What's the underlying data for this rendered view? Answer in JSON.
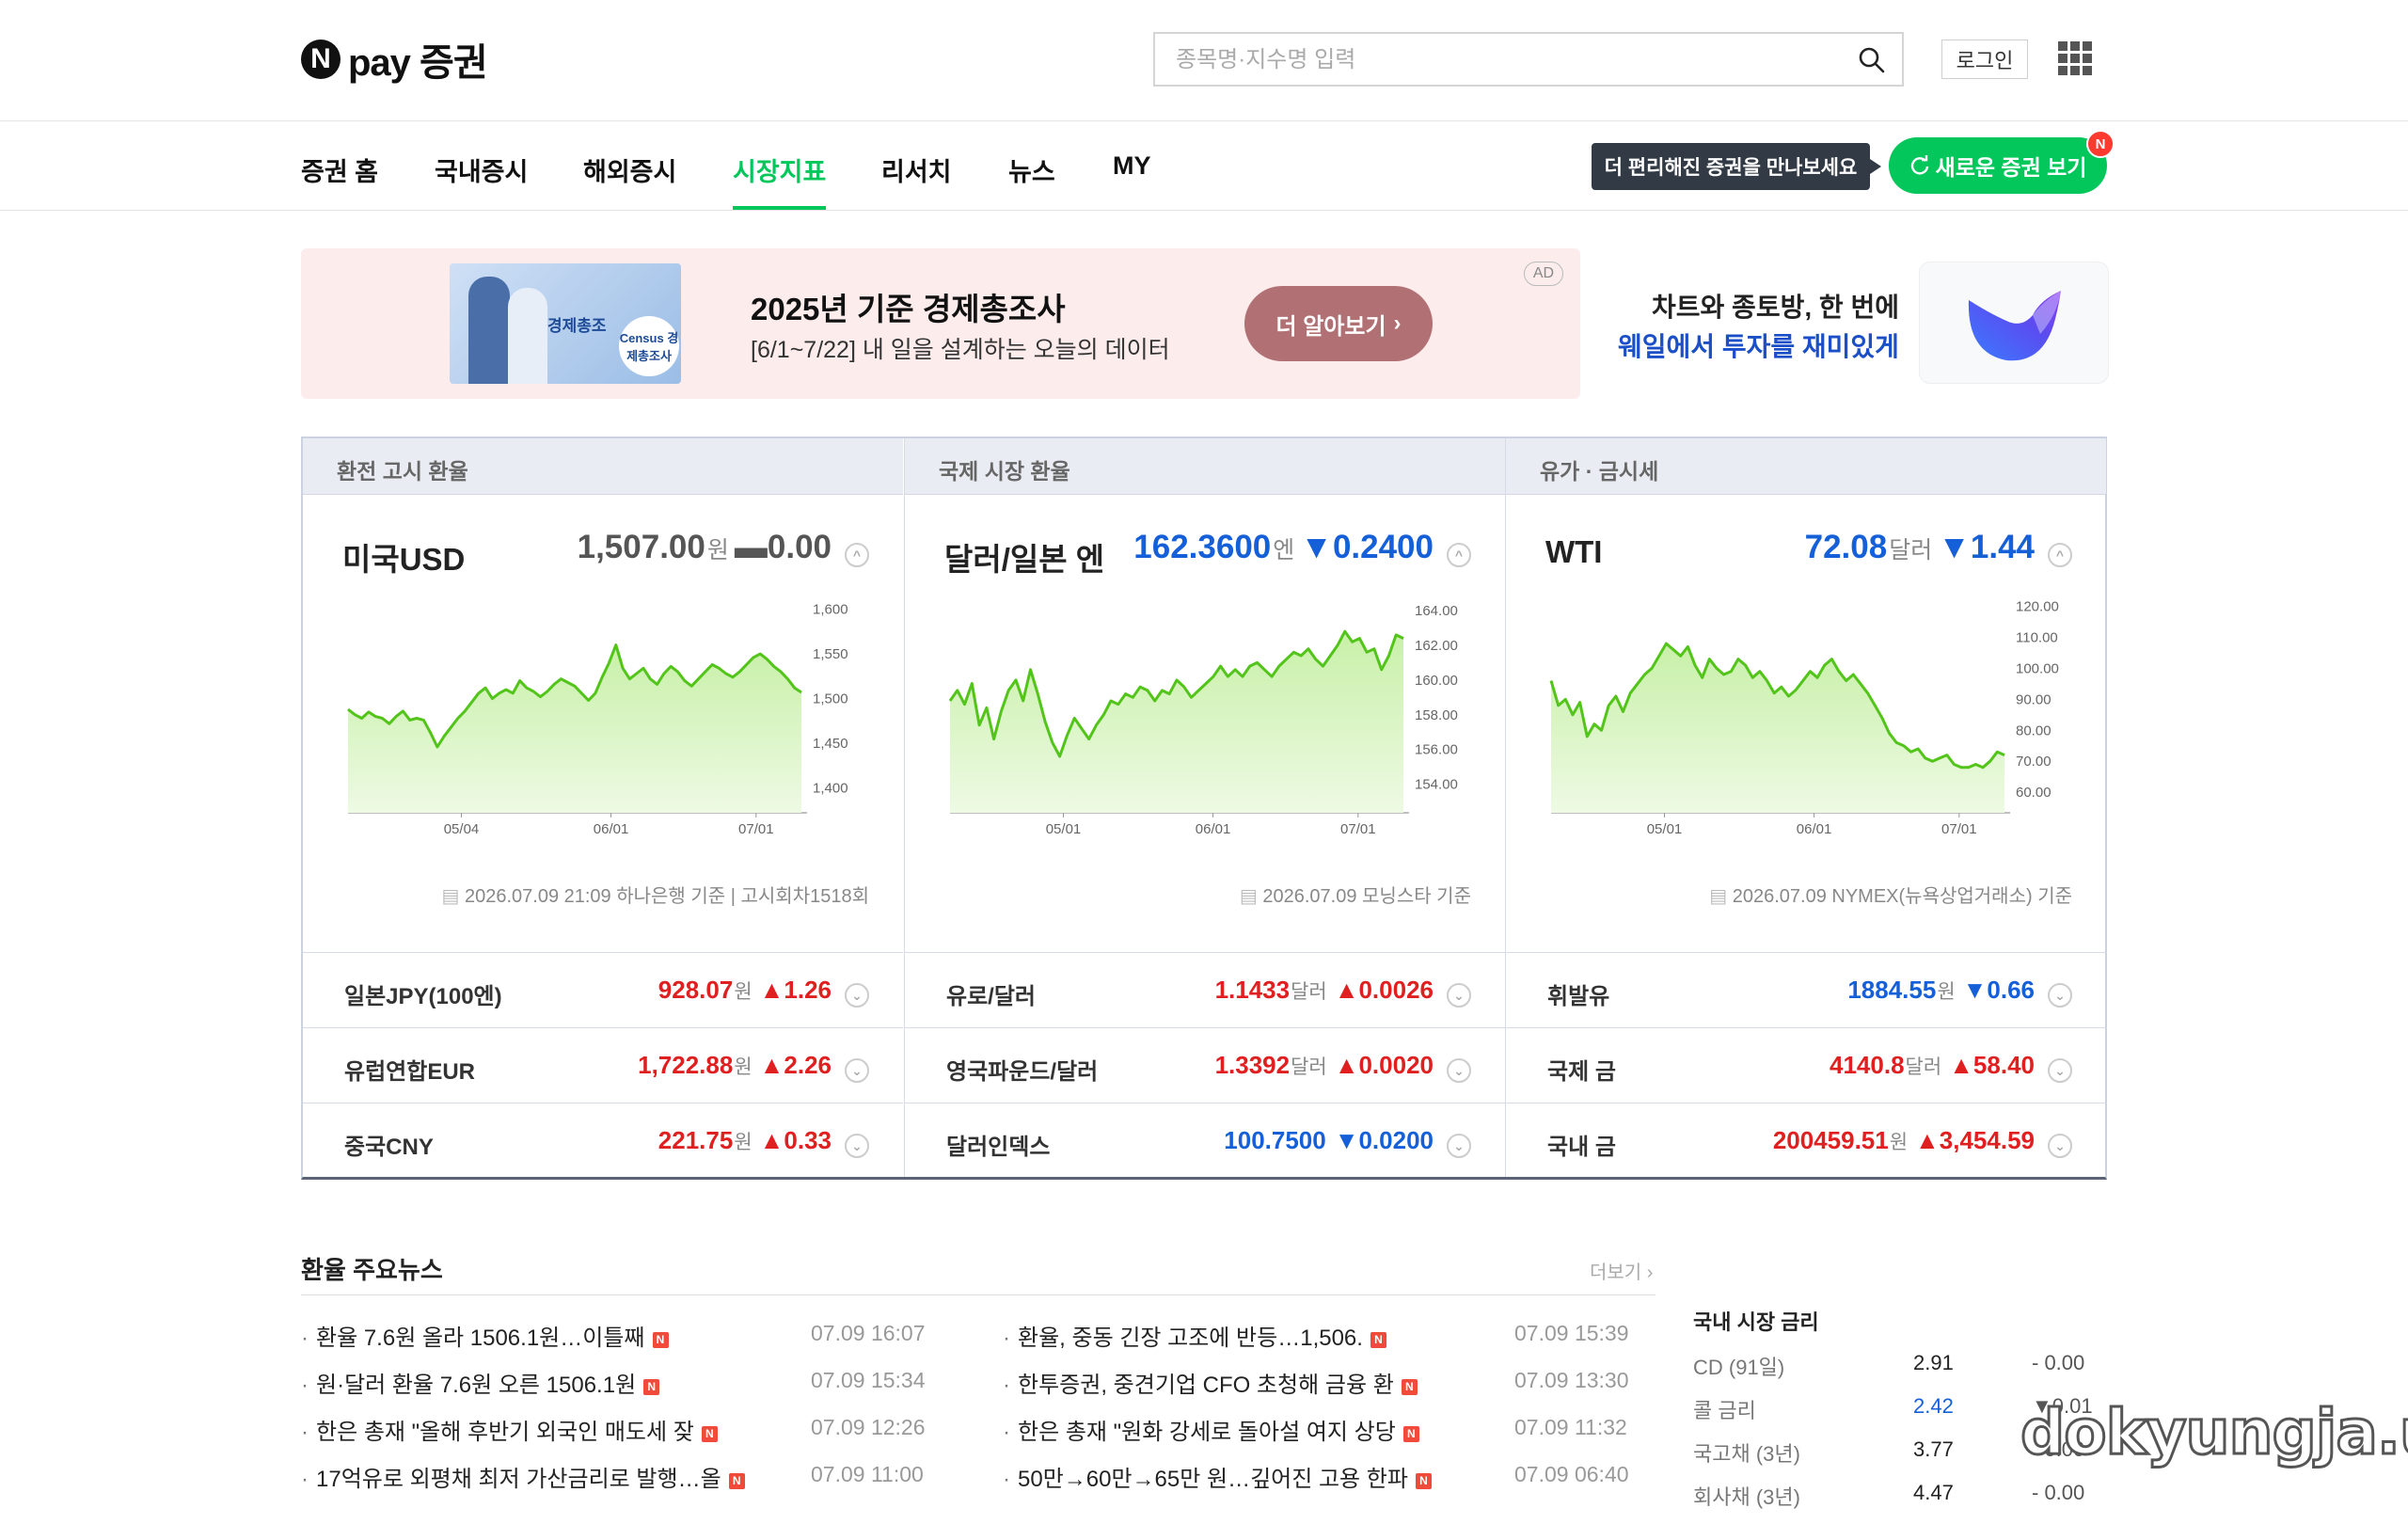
{
  "header": {
    "logo_n": "N",
    "logo_text": "pay 증권",
    "search_placeholder": "종목명·지수명 입력",
    "login_label": "로그인"
  },
  "nav": {
    "items": [
      "증권 홈",
      "국내증시",
      "해외증시",
      "시장지표",
      "리서치",
      "뉴스",
      "MY"
    ],
    "active": "시장지표",
    "tooltip": "더 편리해진 증권을 만나보세요",
    "new_button": "새로운 증권 보기",
    "new_badge": "N"
  },
  "ad": {
    "title": "2025년 기준 경제총조사",
    "subtitle": "[6/1~7/22] 내 일을 설계하는 오늘의 데이터",
    "button": "더 알아보기",
    "tag": "AD",
    "image_text": "경제총조",
    "image_badge": "Census 경제총조사"
  },
  "whale": {
    "line1": "차트와 종토방, 한 번에",
    "line2": "웨일에서 투자를 재미있게"
  },
  "market": {
    "columns": [
      {
        "header": "환전 고시 환율",
        "main": {
          "name": "미국USD",
          "value": "1,507.00",
          "unit": "원",
          "change": "0.00",
          "direction": "flat"
        },
        "source": "2026.07.09 21:09 하나은행 기준 | 고시회차1518회",
        "rows": [
          {
            "name": "일본JPY(100엔)",
            "value": "928.07",
            "unit": "원",
            "change": "1.26",
            "direction": "up"
          },
          {
            "name": "유럽연합EUR",
            "value": "1,722.88",
            "unit": "원",
            "change": "2.26",
            "direction": "up"
          },
          {
            "name": "중국CNY",
            "value": "221.75",
            "unit": "원",
            "change": "0.33",
            "direction": "up"
          }
        ]
      },
      {
        "header": "국제 시장 환율",
        "main": {
          "name": "달러/일본 엔",
          "value": "162.3600",
          "unit": "엔",
          "change": "0.2400",
          "direction": "down"
        },
        "source": "2026.07.09 모닝스타 기준",
        "rows": [
          {
            "name": "유로/달러",
            "value": "1.1433",
            "unit": "달러",
            "change": "0.0026",
            "direction": "up"
          },
          {
            "name": "영국파운드/달러",
            "value": "1.3392",
            "unit": "달러",
            "change": "0.0020",
            "direction": "up"
          },
          {
            "name": "달러인덱스",
            "value": "100.7500",
            "unit": "",
            "change": "0.0200",
            "direction": "down"
          }
        ]
      },
      {
        "header": "유가 · 금시세",
        "main": {
          "name": "WTI",
          "value": "72.08",
          "unit": "달러",
          "change": "1.44",
          "direction": "down"
        },
        "source": "2026.07.09 NYMEX(뉴욕상업거래소) 기준",
        "rows": [
          {
            "name": "휘발유",
            "value": "1884.55",
            "unit": "원",
            "change": "0.66",
            "direction": "down"
          },
          {
            "name": "국제 금",
            "value": "4140.8",
            "unit": "달러",
            "change": "58.40",
            "direction": "up"
          },
          {
            "name": "국내 금",
            "value": "200459.51",
            "unit": "원",
            "change": "3,454.59",
            "direction": "up"
          }
        ]
      }
    ]
  },
  "chart_data": [
    {
      "type": "area",
      "series_name": "미국USD",
      "x_ticks": [
        "05/04",
        "06/01",
        "07/01"
      ],
      "y_ticks": [
        "1,400",
        "1,450",
        "1,500",
        "1,550",
        "1,600"
      ],
      "ylim": [
        1385,
        1610
      ],
      "values": [
        1488,
        1482,
        1478,
        1485,
        1480,
        1478,
        1472,
        1480,
        1486,
        1476,
        1478,
        1476,
        1462,
        1446,
        1458,
        1468,
        1478,
        1486,
        1496,
        1506,
        1512,
        1500,
        1506,
        1510,
        1506,
        1520,
        1512,
        1508,
        1502,
        1508,
        1516,
        1522,
        1518,
        1514,
        1506,
        1498,
        1506,
        1524,
        1540,
        1560,
        1534,
        1522,
        1528,
        1534,
        1522,
        1516,
        1528,
        1536,
        1530,
        1520,
        1514,
        1522,
        1530,
        1538,
        1534,
        1528,
        1524,
        1530,
        1538,
        1546,
        1550,
        1544,
        1536,
        1530,
        1522,
        1512,
        1507
      ]
    },
    {
      "type": "area",
      "series_name": "달러/일본 엔",
      "x_ticks": [
        "05/01",
        "06/01",
        "07/01"
      ],
      "y_ticks": [
        "154.00",
        "156.00",
        "158.00",
        "160.00",
        "162.00",
        "164.00"
      ],
      "ylim": [
        153,
        164.6
      ],
      "values": [
        158.8,
        159.4,
        158.6,
        159.8,
        157.4,
        158.4,
        156.6,
        158.2,
        159.4,
        160.0,
        158.8,
        160.6,
        159.2,
        157.6,
        156.4,
        155.6,
        156.8,
        157.8,
        157.2,
        156.6,
        157.4,
        158.0,
        158.8,
        158.6,
        159.2,
        159.0,
        159.6,
        159.4,
        158.8,
        159.4,
        159.2,
        160.0,
        159.6,
        159.0,
        159.4,
        159.8,
        160.2,
        160.8,
        160.2,
        160.6,
        160.2,
        160.8,
        161.0,
        160.6,
        160.2,
        160.8,
        161.2,
        161.6,
        161.4,
        161.8,
        161.2,
        160.8,
        161.4,
        162.0,
        162.8,
        162.2,
        162.4,
        161.6,
        161.8,
        160.6,
        161.4,
        162.6,
        162.4
      ]
    },
    {
      "type": "area",
      "series_name": "WTI",
      "x_ticks": [
        "05/01",
        "06/01",
        "07/01"
      ],
      "y_ticks": [
        "60.00",
        "70.00",
        "80.00",
        "90.00",
        "100.00",
        "110.00",
        "120.00"
      ],
      "ylim": [
        57,
        122
      ],
      "values": [
        96,
        88,
        90,
        85,
        89,
        78,
        82,
        80,
        88,
        91,
        86,
        92,
        95,
        98,
        100,
        104,
        108,
        106,
        104,
        107,
        101,
        97,
        103,
        100,
        98,
        99,
        103,
        101,
        97,
        99,
        96,
        92,
        94,
        91,
        93,
        96,
        99,
        97,
        101,
        103,
        99,
        96,
        98,
        95,
        92,
        88,
        84,
        79,
        76,
        75,
        73,
        74,
        71,
        70,
        71,
        72,
        69,
        68,
        68,
        69,
        68,
        70,
        73,
        72
      ]
    }
  ],
  "news": {
    "title": "환율 주요뉴스",
    "more": "더보기",
    "left": [
      {
        "text": "환율 7.6원 올라 1506.1원…이틀째",
        "time": "07.09 16:07"
      },
      {
        "text": "원·달러 환율 7.6원 오른 1506.1원",
        "time": "07.09 15:34"
      },
      {
        "text": "한은 총재 \"올해 후반기 외국인 매도세 잦",
        "time": "07.09 12:26"
      },
      {
        "text": "17억유로 외평채 최저 가산금리로 발행…올",
        "time": "07.09 11:00"
      }
    ],
    "right": [
      {
        "text": "환율, 중동 긴장 고조에 반등…1,506.",
        "time": "07.09 15:39"
      },
      {
        "text": "한투증권, 중견기업 CFO 초청해 금융 환",
        "time": "07.09 13:30"
      },
      {
        "text": "한은 총재 \"원화 강세로 돌아설 여지 상당",
        "time": "07.09 11:32"
      },
      {
        "text": "50만→60만→65만 원…깊어진 고용 한파",
        "time": "07.09 06:40"
      }
    ],
    "badge": "N"
  },
  "rates": {
    "title": "국내 시장 금리",
    "items": [
      {
        "name": "CD (91일)",
        "value": "2.91",
        "change": "- 0.00",
        "direction": "flat"
      },
      {
        "name": "콜 금리",
        "value": "2.42",
        "change": "▼0.01",
        "direction": "down"
      },
      {
        "name": "국고채 (3년)",
        "value": "3.77",
        "change": "- 0.00",
        "direction": "flat"
      },
      {
        "name": "회사채 (3년)",
        "value": "4.47",
        "change": "- 0.00",
        "direction": "flat"
      }
    ]
  },
  "watermark": "dokyungja.us",
  "colors": {
    "up": "#e02020",
    "down": "#1560d8",
    "accent": "#03c75a",
    "chart_line": "#52c41a",
    "chart_fill": "#c8f0a8"
  }
}
